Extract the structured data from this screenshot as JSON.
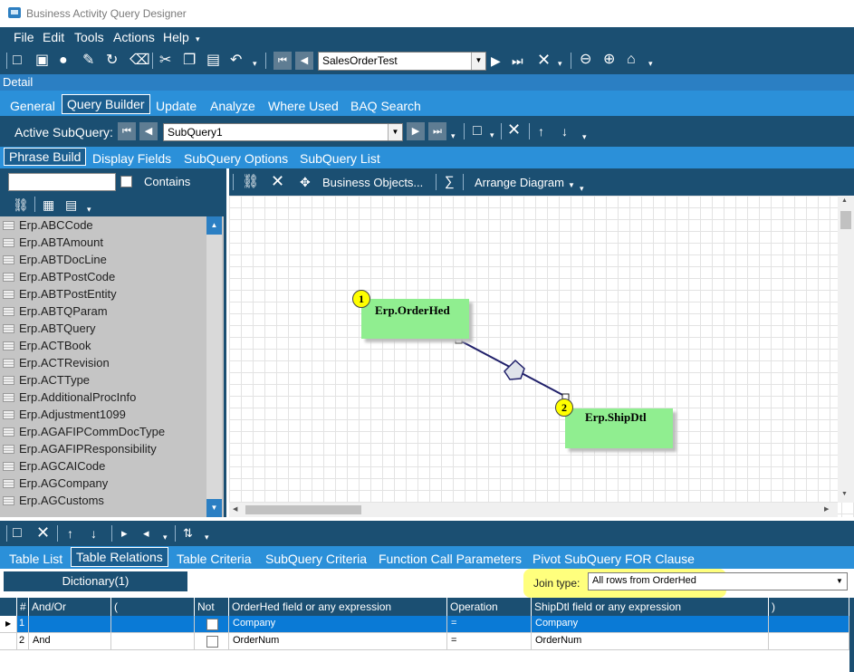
{
  "window": {
    "title": "Business Activity Query Designer"
  },
  "menu": [
    "File",
    "Edit",
    "Tools",
    "Actions",
    "Help"
  ],
  "toolbar": {
    "query_id": "SalesOrderTest"
  },
  "detail_label": "Detail",
  "main_tabs": [
    "General",
    "Query Builder",
    "Update",
    "Analyze",
    "Where Used",
    "BAQ Search"
  ],
  "subquery": {
    "label": "Active SubQuery:",
    "value": "SubQuery1"
  },
  "sub_tabs": [
    "Phrase Build",
    "Display Fields",
    "SubQuery Options",
    "SubQuery List"
  ],
  "left_panel": {
    "contains_label": "Contains",
    "tables": [
      "Erp.ABCCode",
      "Erp.ABTAmount",
      "Erp.ABTDocLine",
      "Erp.ABTPostCode",
      "Erp.ABTPostEntity",
      "Erp.ABTQParam",
      "Erp.ABTQuery",
      "Erp.ACTBook",
      "Erp.ACTRevision",
      "Erp.ACTType",
      "Erp.AdditionalProcInfo",
      "Erp.Adjustment1099",
      "Erp.AGAFIPCommDocType",
      "Erp.AGAFIPResponsibility",
      "Erp.AGCAICode",
      "Erp.AGCompany",
      "Erp.AGCustoms"
    ]
  },
  "diagram_toolbar": {
    "business_objects": "Business Objects...",
    "arrange": "Arrange Diagram"
  },
  "diagram": {
    "nodes": [
      {
        "num": "1",
        "name": "Erp.OrderHed"
      },
      {
        "num": "2",
        "name": "Erp.ShipDtl"
      }
    ]
  },
  "bottom_tabs": [
    "Table List",
    "Table Relations",
    "Table Criteria",
    "SubQuery Criteria",
    "Function Call Parameters",
    "Pivot SubQuery FOR Clause"
  ],
  "relations": {
    "dictionary": "Dictionary(1)",
    "join_label": "Join type:",
    "join_value": "All rows from OrderHed"
  },
  "grid": {
    "headers": [
      "#",
      "And/Or",
      "(",
      "Not",
      "OrderHed field or any expression",
      "Operation",
      "ShipDtl field or any expression",
      ")"
    ],
    "rows": [
      {
        "num": "1",
        "andor": "",
        "op": "=",
        "left": "Company",
        "right": "Company"
      },
      {
        "num": "2",
        "andor": "And",
        "op": "=",
        "left": "OrderNum",
        "right": "OrderNum"
      }
    ]
  },
  "colors": {
    "dark": "#1b4f72",
    "tab": "#2b90d9",
    "node": "#90ee90",
    "badge": "#ffff00",
    "highlight": "#ffff66"
  }
}
